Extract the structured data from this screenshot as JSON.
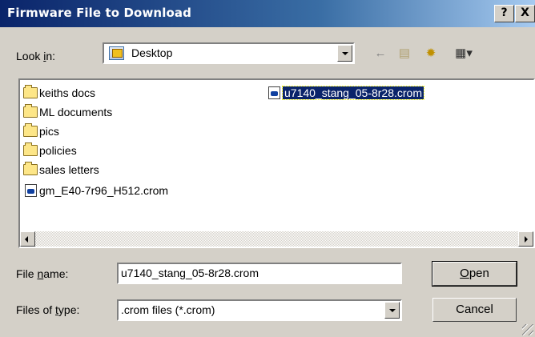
{
  "window": {
    "title": "Firmware File to Download",
    "help_label": "?",
    "close_label": "X"
  },
  "lookin": {
    "label_pre": "Look ",
    "label_key": "i",
    "label_post": "n:",
    "value": "Desktop",
    "icon": "desktop-icon"
  },
  "toolbar": {
    "back_icon": "back-arrow-icon",
    "up_icon": "up-folder-icon",
    "new_folder_icon": "new-folder-icon",
    "view_icon": "view-menu-icon"
  },
  "files": [
    {
      "name": "keiths docs",
      "type": "folder"
    },
    {
      "name": "ML documents",
      "type": "folder"
    },
    {
      "name": "pics",
      "type": "folder"
    },
    {
      "name": "policies",
      "type": "folder"
    },
    {
      "name": "sales letters",
      "type": "folder"
    },
    {
      "name": "gm_E40-7r96_H512.crom",
      "type": "crom"
    },
    {
      "name": "u7140_stang_05-8r28.crom",
      "type": "crom",
      "selected": true
    }
  ],
  "filename": {
    "label_pre": "File ",
    "label_key": "n",
    "label_post": "ame:",
    "value": "u7140_stang_05-8r28.crom"
  },
  "filetype": {
    "label_pre": "Files of ",
    "label_key": "t",
    "label_post": "ype:",
    "value": ".crom files (*.crom)"
  },
  "buttons": {
    "open_key": "O",
    "open_rest": "pen",
    "cancel": "Cancel"
  }
}
